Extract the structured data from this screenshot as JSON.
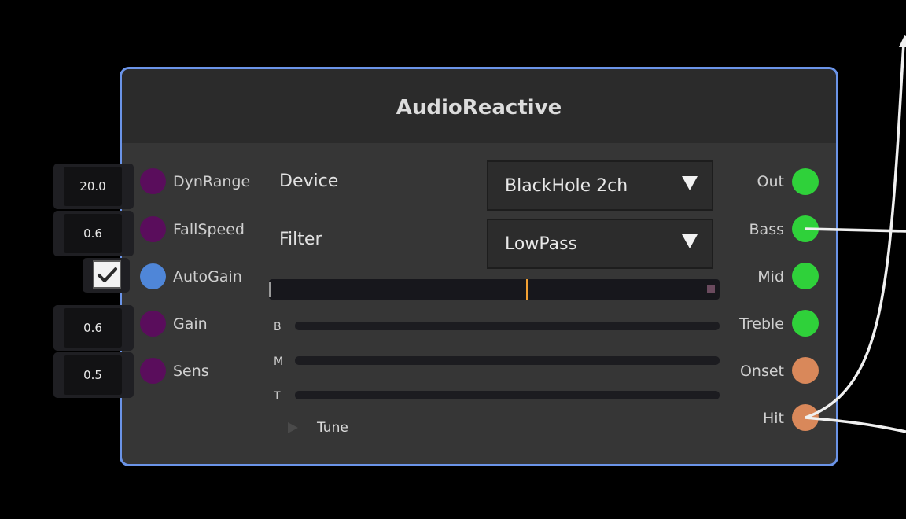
{
  "node": {
    "title": "AudioReactive",
    "inputs": [
      {
        "label": "DynRange",
        "value": "20.0",
        "socket_color": "#5a0d5c"
      },
      {
        "label": "FallSpeed",
        "value": "0.6",
        "socket_color": "#5a0d5c"
      },
      {
        "label": "AutoGain",
        "checked": true,
        "socket_color": "#4f86d8"
      },
      {
        "label": "Gain",
        "value": "0.6",
        "socket_color": "#5a0d5c"
      },
      {
        "label": "Sens",
        "value": "0.5",
        "socket_color": "#5a0d5c"
      }
    ],
    "device": {
      "label": "Device",
      "value": "BlackHole 2ch"
    },
    "filter": {
      "label": "Filter",
      "value": "LowPass"
    },
    "level": {
      "marker_fraction": 0.57
    },
    "bands": [
      "B",
      "M",
      "T"
    ],
    "tune_label": "Tune",
    "outputs": [
      {
        "label": "Out",
        "socket_color": "#2fd13a"
      },
      {
        "label": "Bass",
        "socket_color": "#2fd13a"
      },
      {
        "label": "Mid",
        "socket_color": "#2fd13a"
      },
      {
        "label": "Treble",
        "socket_color": "#2fd13a"
      },
      {
        "label": "Onset",
        "socket_color": "#d9885a"
      },
      {
        "label": "Hit",
        "socket_color": "#d9885a"
      }
    ]
  },
  "colors": {
    "node_border": "#6b94e8",
    "wire": "#f0f0f0",
    "level_marker": "#f2a033"
  }
}
